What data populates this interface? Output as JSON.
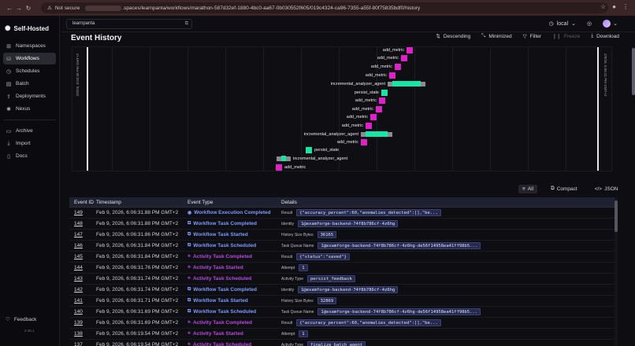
{
  "browser": {
    "not_secure": "Not secure",
    "url_path": ".spaces/learnpanta/workflows/marathon-587d32ef-1880-4bc0-aa67-0b030552f605/019c4324-ca96-7355-a55f-80f75835bdf0/history"
  },
  "sidebar": {
    "brand": "Self-Hosted",
    "items": [
      {
        "label": "Namespaces",
        "icon": "namespaces-icon"
      },
      {
        "label": "Workflows",
        "icon": "workflows-icon"
      },
      {
        "label": "Schedules",
        "icon": "schedules-icon"
      },
      {
        "label": "Batch",
        "icon": "batch-icon"
      },
      {
        "label": "Deployments",
        "icon": "deployments-icon"
      },
      {
        "label": "Nexus",
        "icon": "nexus-icon"
      }
    ],
    "items2": [
      {
        "label": "Archive",
        "icon": "archive-icon"
      },
      {
        "label": "Import",
        "icon": "import-icon"
      },
      {
        "label": "Docs",
        "icon": "docs-icon"
      }
    ],
    "feedback": "Feedback",
    "version": "2.45.1"
  },
  "topbar": {
    "namespace": "learnpanta",
    "timezone": "local"
  },
  "header": {
    "title": "Event History",
    "descending": "Descending",
    "minimized": "Minimized",
    "filter": "Filter",
    "freeze": "Freeze",
    "download": "Download"
  },
  "timeline": {
    "start_label": "2/9/26, 6:03:38 PM GMT+2",
    "end_label": "2/9/26, 6:06:31 PM GMT+2",
    "rows": [
      {
        "label": "add_metric",
        "type": "metric",
        "label_side": "left"
      },
      {
        "label": "add_metric",
        "type": "metric",
        "label_side": "left"
      },
      {
        "label": "add_metric",
        "type": "metric",
        "label_side": "left"
      },
      {
        "label": "add_metric",
        "type": "metric",
        "label_side": "left"
      },
      {
        "label": "incremental_analyzer_agent",
        "type": "agent",
        "label_side": "left"
      },
      {
        "label": "persist_state",
        "type": "persist",
        "label_side": "left"
      },
      {
        "label": "add_metric",
        "type": "metric",
        "label_side": "left"
      },
      {
        "label": "add_metric",
        "type": "metric",
        "label_side": "left"
      },
      {
        "label": "add_metric",
        "type": "metric",
        "label_side": "left"
      },
      {
        "label": "add_metric",
        "type": "metric",
        "label_side": "left"
      },
      {
        "label": "incremental_analyzer_agent",
        "type": "agent",
        "label_side": "left"
      },
      {
        "label": "add_metric",
        "type": "metric",
        "label_side": "left"
      },
      {
        "label": "persist_state",
        "type": "persist",
        "label_side": "right"
      },
      {
        "label": "incremental_analyzer_agent",
        "type": "agent",
        "label_side": "right"
      },
      {
        "label": "add_metric",
        "type": "metric",
        "label_side": "right"
      },
      {
        "label": "persist_state",
        "type": "persist",
        "label_side": "right"
      }
    ]
  },
  "view_tabs": {
    "all": "All",
    "compact": "Compact",
    "json": "JSON"
  },
  "table": {
    "headers": [
      "Event ID",
      "Timestamp",
      "Event Type",
      "Details"
    ],
    "rows": [
      {
        "id": "149",
        "ts": "Feb 9, 2026, 6:06:31.88 PM GMT+2",
        "type": "Workflow Execution Completed",
        "kind": "blue",
        "dkey": "Result",
        "dval": "{\"accuracy_percent\":60,\"anomalies_detected\":[],\"be..."
      },
      {
        "id": "148",
        "ts": "Feb 9, 2026, 6:06:31.88 PM GMT+2",
        "type": "Workflow Task Completed",
        "kind": "blue",
        "dkey": "Identity",
        "dval": "1@examforge-backend-74f8b786cf-4z6hg"
      },
      {
        "id": "147",
        "ts": "Feb 9, 2026, 6:06:31.86 PM GMT+2",
        "type": "Workflow Task Started",
        "kind": "blue",
        "dkey": "History Size Bytes",
        "dval": "36165"
      },
      {
        "id": "146",
        "ts": "Feb 9, 2026, 6:06:31.84 PM GMT+2",
        "type": "Workflow Task Scheduled",
        "kind": "blue",
        "dkey": "Task Queue Name",
        "dval": "1@examforge-backend-74f8b786cf-4z6hg-de56f14958ea41ff98b5..."
      },
      {
        "id": "145",
        "ts": "Feb 9, 2026, 6:06:31.84 PM GMT+2",
        "type": "Activity Task Completed",
        "kind": "purple",
        "dkey": "Result",
        "dval": "{\"status\":\"saved\"}"
      },
      {
        "id": "144",
        "ts": "Feb 9, 2026, 6:06:31.76 PM GMT+2",
        "type": "Activity Task Started",
        "kind": "purple",
        "dkey": "Attempt",
        "dval": "1"
      },
      {
        "id": "143",
        "ts": "Feb 9, 2026, 6:06:31.74 PM GMT+2",
        "type": "Activity Task Scheduled",
        "kind": "purple",
        "dkey": "Activity Type",
        "dval": "persist_feedback"
      },
      {
        "id": "142",
        "ts": "Feb 9, 2026, 6:06:31.74 PM GMT+2",
        "type": "Workflow Task Completed",
        "kind": "blue",
        "dkey": "Identity",
        "dval": "1@examforge-backend-74f8b786cf-4z6hg"
      },
      {
        "id": "141",
        "ts": "Feb 9, 2026, 6:06:31.71 PM GMT+2",
        "type": "Workflow Task Started",
        "kind": "blue",
        "dkey": "History Size Bytes",
        "dval": "32869"
      },
      {
        "id": "140",
        "ts": "Feb 9, 2026, 6:06:31.69 PM GMT+2",
        "type": "Workflow Task Scheduled",
        "kind": "blue",
        "dkey": "Task Queue Name",
        "dval": "1@examforge-backend-74f8b786cf-4z6hg-de56f14958ea41ff98b5..."
      },
      {
        "id": "139",
        "ts": "Feb 9, 2026, 6:06:31.69 PM GMT+2",
        "type": "Activity Task Completed",
        "kind": "purple",
        "dkey": "Result",
        "dval": "{\"accuracy_percent\":60,\"anomalies_detected\":[],\"be..."
      },
      {
        "id": "138",
        "ts": "Feb 9, 2026, 6:06:19.54 PM GMT+2",
        "type": "Activity Task Started",
        "kind": "purple",
        "dkey": "Attempt",
        "dval": "1"
      },
      {
        "id": "137",
        "ts": "Feb 9, 2026, 6:06:19.54 PM GMT+2",
        "type": "Activity Task Scheduled",
        "kind": "purple",
        "dkey": "Activity Type",
        "dval": "finalize_batch_agent"
      }
    ]
  }
}
